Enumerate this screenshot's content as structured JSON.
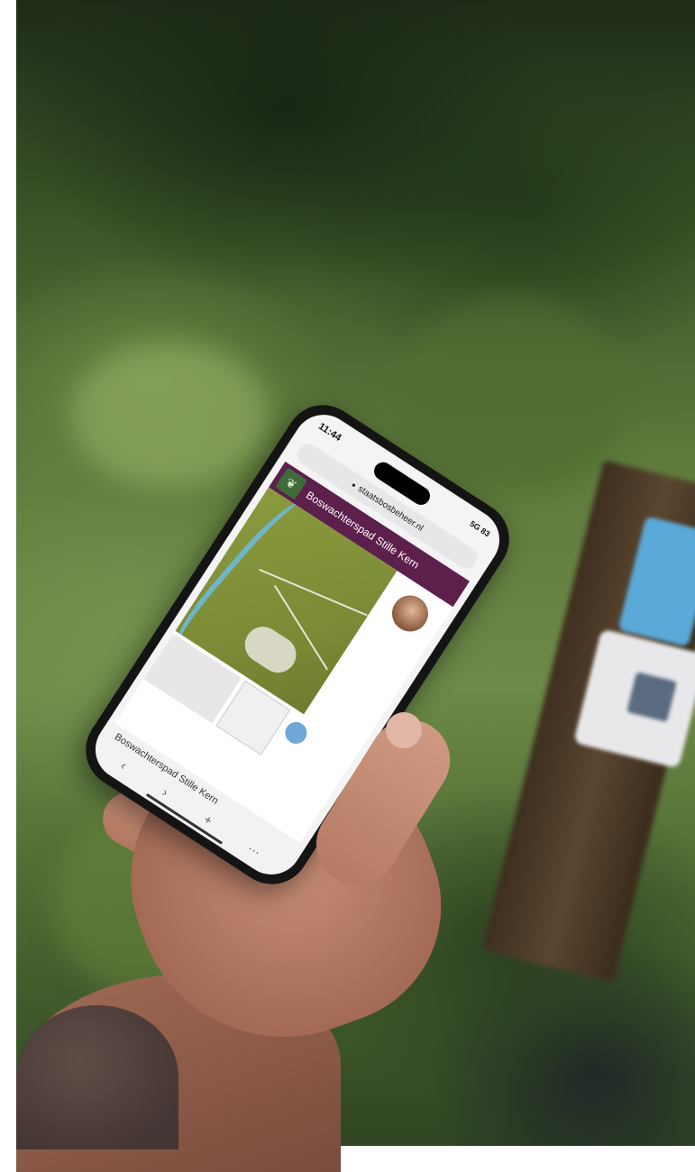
{
  "status_bar": {
    "time": "11:44",
    "signal": "5G",
    "battery": "83"
  },
  "browser": {
    "url": "staatsbosbeheer.nl"
  },
  "page": {
    "title": "Boswachterspad Stille Kern",
    "tab_title": "Boswachterspad Stille Kern"
  },
  "nav": {
    "back": "‹",
    "forward": "›",
    "add": "+",
    "more": "···"
  },
  "colors": {
    "header": "#5d1f4c",
    "map_green": "#7c8c36",
    "water": "#6fb5c9"
  }
}
